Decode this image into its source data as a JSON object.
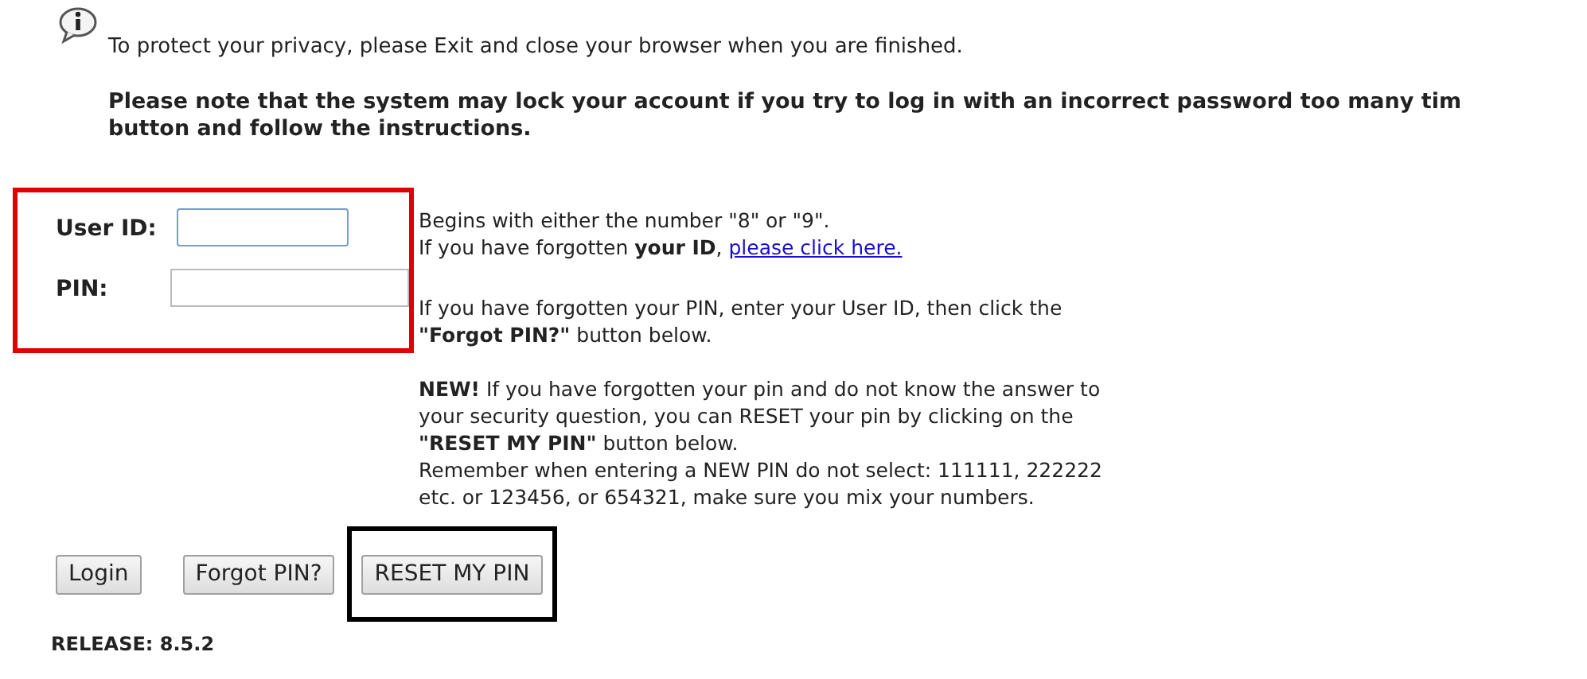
{
  "privacy_notice": "To protect your privacy, please Exit and close your browser when you are finished.",
  "lock_warning": [
    "Please note that the system may lock your account if you try to log in with an incorrect password too many tim",
    "button and follow the instructions."
  ],
  "fields": [
    {
      "label": "User ID:",
      "focused": true
    },
    {
      "label": "PIN:",
      "focused": false
    }
  ],
  "help": {
    "id_hint": "Begins with either the number \"8\" or \"9\".",
    "forgot_id": "If you have forgotten **your ID**,",
    "forgot_id_link": "please click here.",
    "forgot_pin": "If you have forgotten your PIN, enter your User ID, then click the **\"Forgot PIN?\"** button below.",
    "reset_pin": "**NEW!** If you have forgotten your pin and do not know the answer to your security question, you can RESET your pin by clicking on the **\"RESET MY PIN\"** button below.",
    "pin_rules": "Remember when entering a NEW PIN do not select: 111111, 222222 etc. or 123456, or 654321, make sure you mix your numbers."
  },
  "buttons": [
    {
      "label": "Login"
    },
    {
      "label": "Forgot PIN?"
    },
    {
      "label": "RESET MY PIN"
    }
  ],
  "release": "RELEASE: 8.5.2"
}
